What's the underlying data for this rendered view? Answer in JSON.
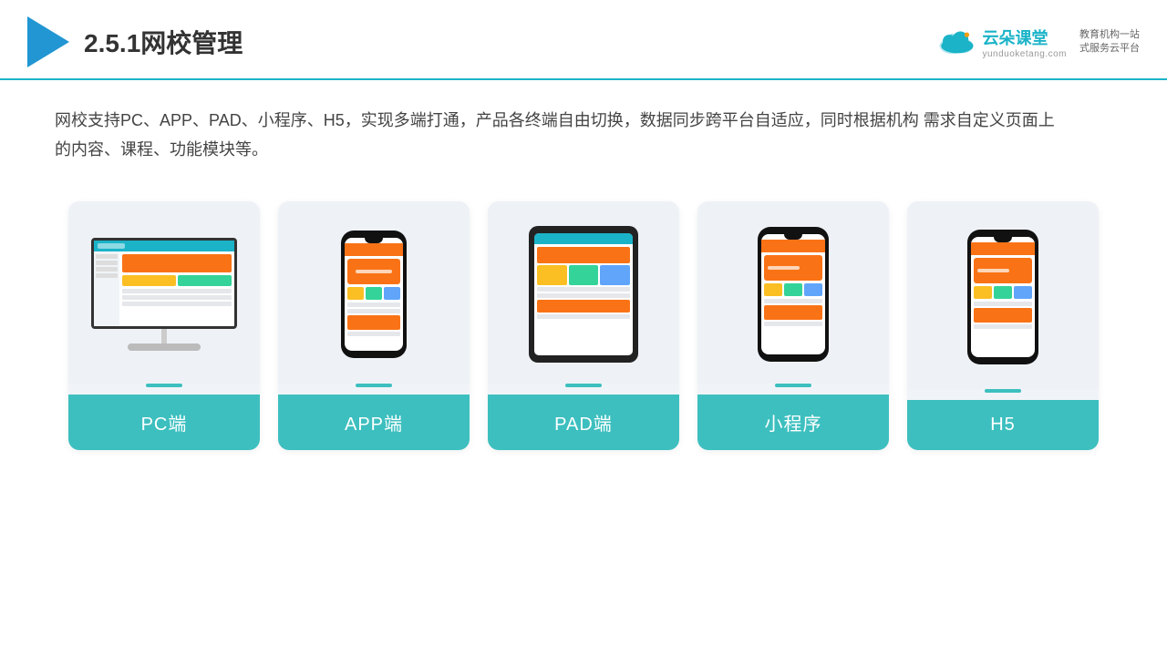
{
  "header": {
    "title": "2.5.1网校管理",
    "brand_name": "云朵课堂",
    "brand_url": "yunduoketang.com",
    "brand_slogan": "教育机构一站\n式服务云平台"
  },
  "description": "网校支持PC、APP、PAD、小程序、H5，实现多端打通，产品各终端自由切换，数据同步跨平台自适应，同时根据机构\n需求自定义页面上的内容、课程、功能模块等。",
  "cards": [
    {
      "id": "pc",
      "label": "PC端"
    },
    {
      "id": "app",
      "label": "APP端"
    },
    {
      "id": "pad",
      "label": "PAD端"
    },
    {
      "id": "miniapp",
      "label": "小程序"
    },
    {
      "id": "h5",
      "label": "H5"
    }
  ],
  "colors": {
    "accent": "#1ab3c8",
    "card_bg": "#eef2f7",
    "card_label_bg": "#3dbfbf"
  }
}
